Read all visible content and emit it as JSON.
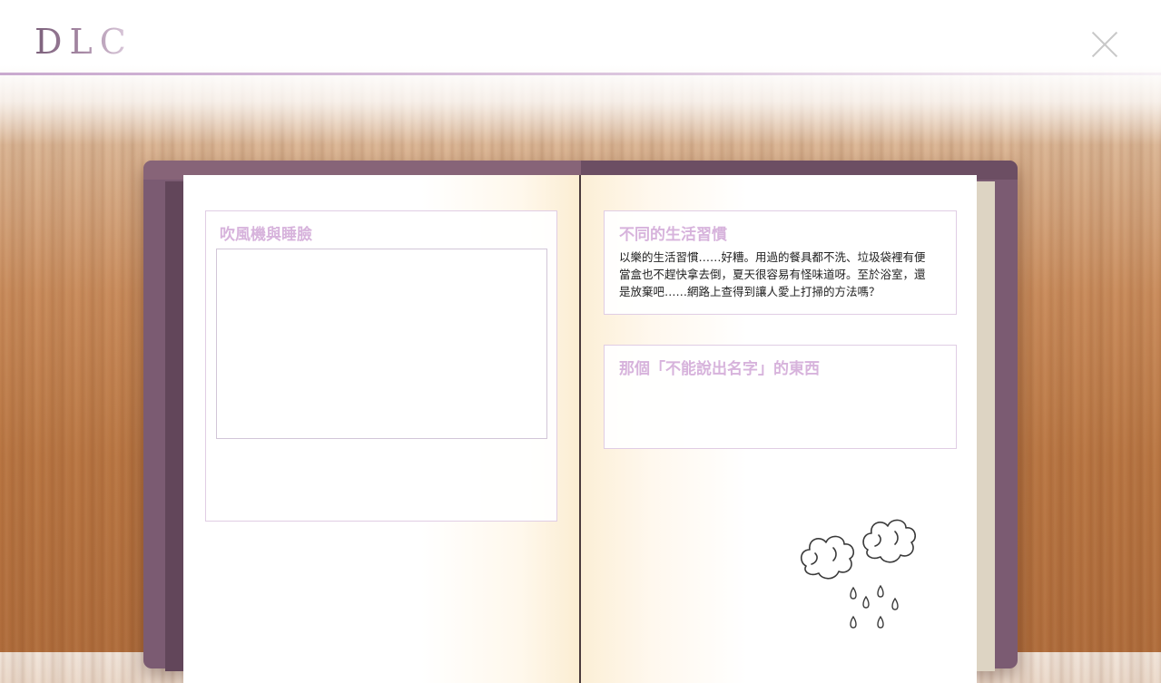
{
  "header": {
    "logo_text": "DLC",
    "close_icon": "close-icon"
  },
  "left_page": {
    "card": {
      "title": "吹風機與睡臉"
    }
  },
  "right_page": {
    "card1": {
      "title": "不同的生活習慣",
      "lines": [
        "以樂的生活習慣……好糟。用過的餐具都不洗、垃圾袋裡有便",
        "當盒也不趕快拿去倒，夏天很容易有怪味道呀。至於浴室，還",
        "是放棄吧……網路上查得到讓人愛上打掃的方法嗎？"
      ]
    },
    "card2": {
      "title": "那個「不能說出名字」的東西"
    },
    "doodle_icon": "rain-cloud-doodle-icon"
  },
  "colors": {
    "book_cover": "#7b5b72",
    "card_title": "#d7b3dc",
    "card_border": "#e0cde4"
  }
}
